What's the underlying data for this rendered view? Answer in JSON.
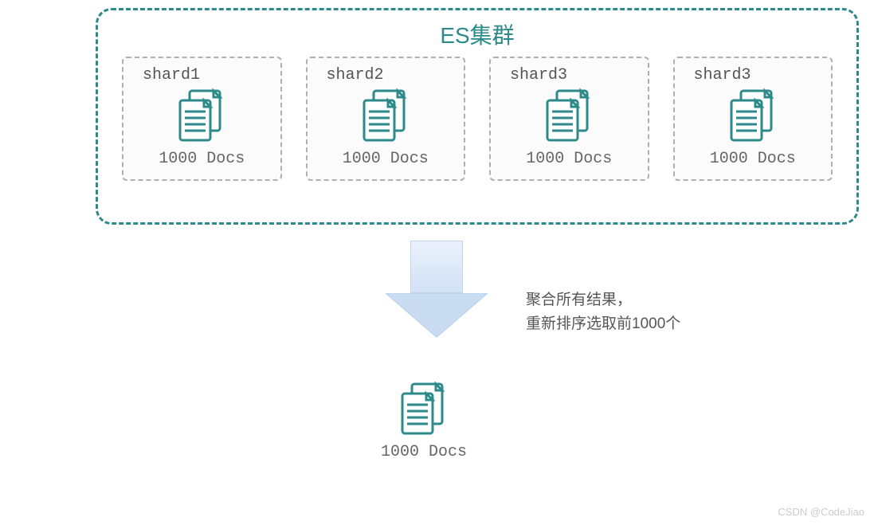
{
  "cluster": {
    "title": "ES集群",
    "shards": [
      {
        "label": "shard1",
        "docs": "1000 Docs"
      },
      {
        "label": "shard2",
        "docs": "1000 Docs"
      },
      {
        "label": "shard3",
        "docs": "1000 Docs"
      },
      {
        "label": "shard3",
        "docs": "1000 Docs"
      }
    ]
  },
  "annotation": {
    "line1": "聚合所有结果，",
    "line2": "重新排序选取前1000个"
  },
  "result": {
    "docs": "1000 Docs"
  },
  "watermark": {
    "w1": "CSDN @CodeJiao",
    "w2": ""
  }
}
